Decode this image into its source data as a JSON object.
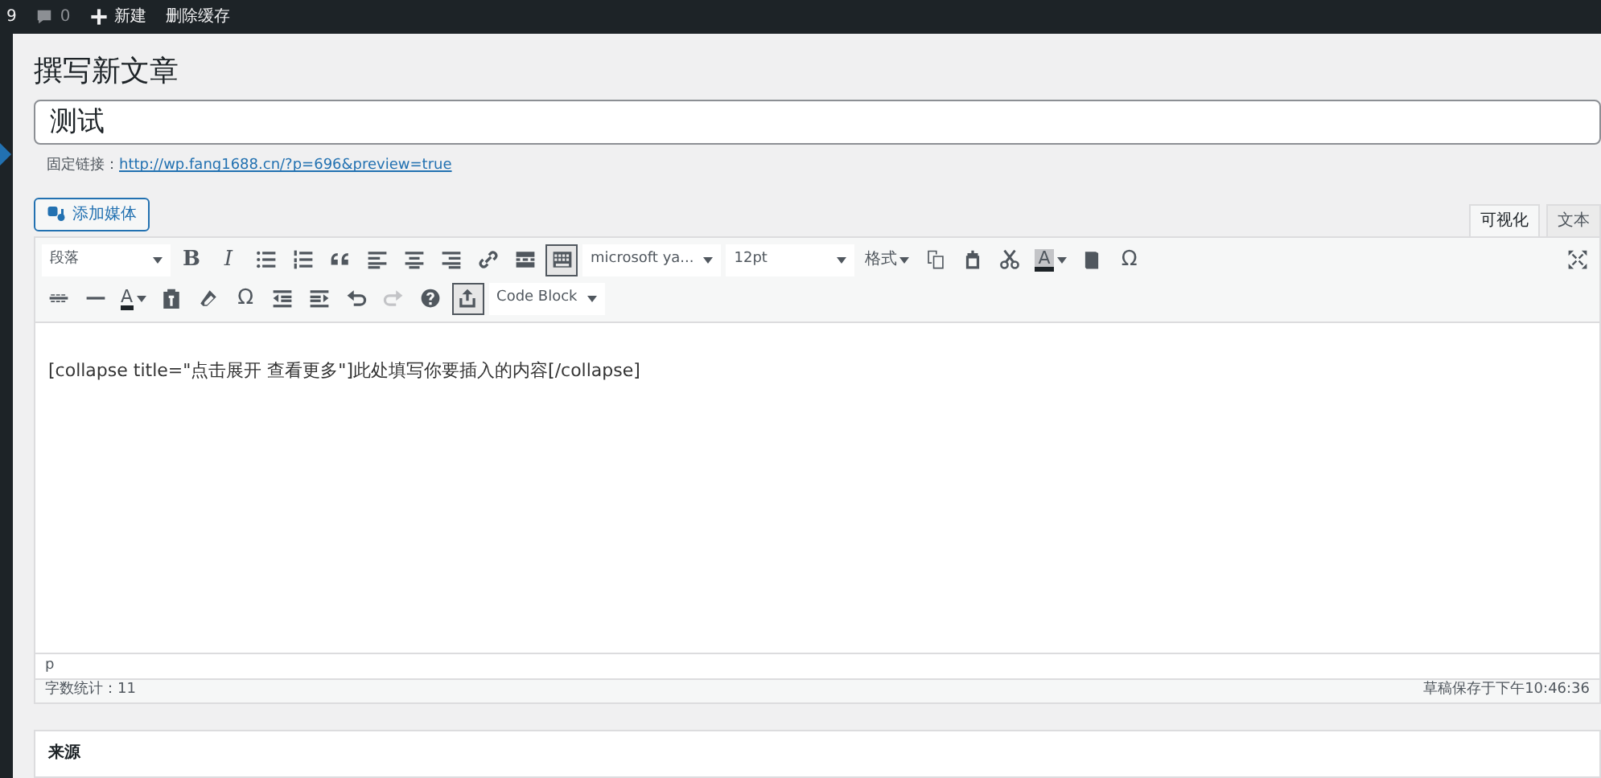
{
  "admin_bar": {
    "updates": "9",
    "comments": "0",
    "new": "新建",
    "clear_cache": "删除缓存"
  },
  "page_title": "撰写新文章",
  "post_title": {
    "value": "测试"
  },
  "permalink": {
    "label": "固定链接：",
    "url": "http://wp.fang1688.cn/?p=696&preview=true"
  },
  "add_media": "添加媒体",
  "editor_tabs": [
    {
      "label": "可视化",
      "selected": true
    },
    {
      "label": "文本",
      "selected": false
    }
  ],
  "toolbar_rows": [
    [
      {
        "kind": "select",
        "value": "段落"
      },
      {
        "kind": "glyph",
        "text": "B"
      },
      {
        "kind": "glyph",
        "text": "I"
      },
      {
        "kind": "icon"
      },
      {
        "kind": "icon"
      },
      {
        "kind": "icon"
      },
      {
        "kind": "icon"
      },
      {
        "kind": "icon"
      },
      {
        "kind": "icon"
      },
      {
        "kind": "icon"
      },
      {
        "kind": "icon"
      },
      {
        "kind": "icon",
        "pressed": true
      },
      {
        "kind": "select",
        "value": "microsoft ya..."
      },
      {
        "kind": "select",
        "value": "12pt"
      },
      {
        "kind": "menu",
        "value": "格式"
      },
      {
        "kind": "icon"
      },
      {
        "kind": "icon"
      },
      {
        "kind": "icon"
      },
      {
        "kind": "color",
        "text": "A"
      },
      {
        "kind": "icon"
      },
      {
        "kind": "glyph",
        "text": "Ω"
      }
    ],
    [
      {
        "kind": "icon"
      },
      {
        "kind": "icon"
      },
      {
        "kind": "color",
        "text": "A"
      },
      {
        "kind": "icon"
      },
      {
        "kind": "icon"
      },
      {
        "kind": "glyph",
        "text": "Ω"
      },
      {
        "kind": "icon"
      },
      {
        "kind": "icon"
      },
      {
        "kind": "icon"
      },
      {
        "kind": "icon",
        "disabled": true
      },
      {
        "kind": "icon"
      },
      {
        "kind": "icon",
        "pressed": true
      },
      {
        "kind": "select",
        "value": "Code Block"
      }
    ]
  ],
  "content": "[collapse title=\"点击展开 查看更多\"]此处填写你要插入的内容[/collapse]",
  "path": "p",
  "word_count": "字数统计：11",
  "draft_saved": "草稿保存于下午10:46:36",
  "source_box": {
    "title": "来源"
  }
}
